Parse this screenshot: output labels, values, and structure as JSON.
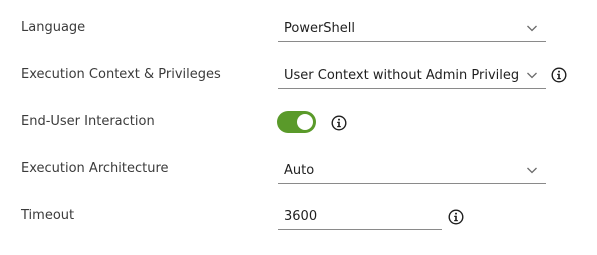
{
  "form": {
    "language": {
      "label": "Language",
      "value": "PowerShell",
      "chevron_icon": "chevron-down-icon"
    },
    "execution_context": {
      "label": "Execution Context & Privileges",
      "value": "User Context without Admin Privileges",
      "chevron_icon": "chevron-down-icon",
      "info_icon": "info-icon"
    },
    "end_user_interaction": {
      "label": "End-User Interaction",
      "enabled": true,
      "on_color": "#5a9a2a",
      "info_icon": "info-icon"
    },
    "execution_architecture": {
      "label": "Execution Architecture",
      "value": "Auto",
      "chevron_icon": "chevron-down-icon"
    },
    "timeout": {
      "label": "Timeout",
      "value": "3600",
      "info_icon": "info-icon"
    }
  }
}
